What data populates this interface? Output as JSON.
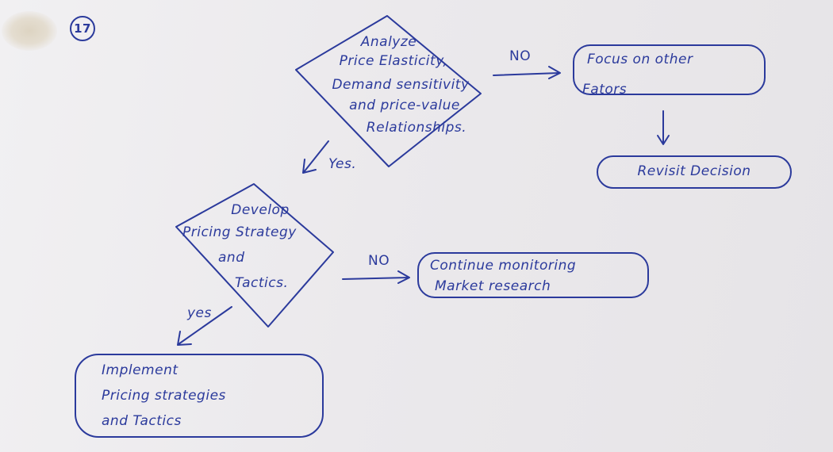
{
  "page_number": "17",
  "colors": {
    "ink": "#2b3a9c",
    "paper": "#ebe9ec"
  },
  "diamond1": {
    "lines": [
      "Analyze",
      "Price Elasticity,",
      "Demand sensitivity",
      "and price-value",
      "Relationships."
    ]
  },
  "diamond2": {
    "lines": [
      "Develop",
      "Pricing Strategy",
      "and",
      "Tactics."
    ]
  },
  "labels": {
    "no_1": "NO",
    "yes_1": "Yes.",
    "no_2": "NO",
    "yes_2": "yes"
  },
  "boxes": {
    "focus_other": [
      "Focus on other",
      "Fators"
    ],
    "revisit": "Revisit Decision",
    "continue_monitoring": [
      "Continue monitoring",
      "Market research"
    ],
    "implement": [
      "Implement",
      "Pricing strategies",
      "and Tactics"
    ]
  }
}
